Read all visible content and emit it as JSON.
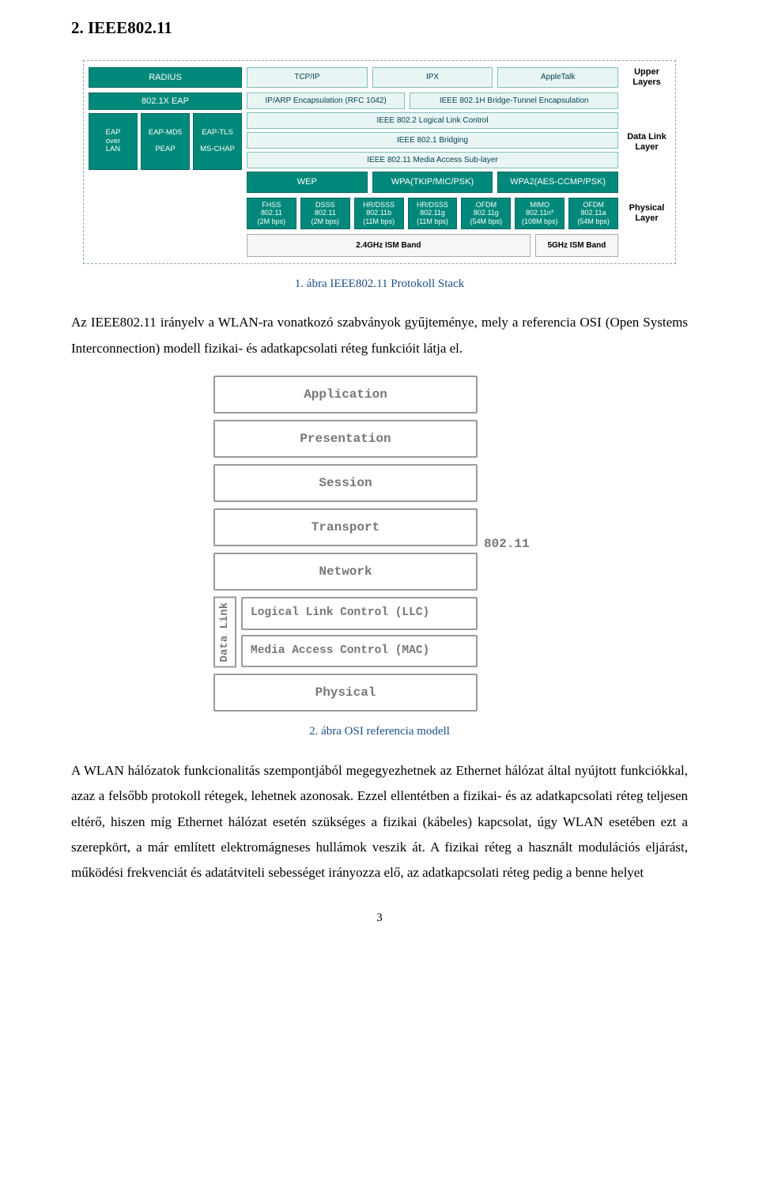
{
  "heading": "2. IEEE802.11",
  "fig1": {
    "caption": "1. ábra IEEE802.11 Protokoll Stack",
    "side_upper": "Upper\nLayers",
    "side_dll": "Data Link\nLayer",
    "side_phy": "Physical\nLayer",
    "radius": "RADIUS",
    "apps": [
      "TCP/IP",
      "IPX",
      "AppleTalk"
    ],
    "x_eap": "802.1X EAP",
    "eap_left_top": [
      "EAP\nover\nLAN",
      "EAP-MD5\n\nPEAP",
      "EAP-TLS\n\nMS-CHAP"
    ],
    "encaps": [
      "IP/ARP Encapsulation (RFC 1042)",
      "IEEE 802.1H Bridge-Tunnel Encapsulation"
    ],
    "llc": "IEEE 802.2 Logical Link Control",
    "bridging": "IEEE 802.1 Bridging",
    "mac_sub": "IEEE 802.11 Media Access Sub-layer",
    "sec": [
      "WEP",
      "WPA(TKIP/MIC/PSK)",
      "WPA2(AES-CCMP/PSK)"
    ],
    "phys": [
      {
        "l1": "FHSS",
        "l2": "802.11",
        "l3": "(2M bps)"
      },
      {
        "l1": "DSSS",
        "l2": "802.11",
        "l3": "(2M bps)"
      },
      {
        "l1": "HR/DSSS",
        "l2": "802.11b",
        "l3": "(11M bps)"
      },
      {
        "l1": "HR/DSSS",
        "l2": "802.11g",
        "l3": "(11M bps)"
      },
      {
        "l1": "OFDM",
        "l2": "802.11g",
        "l3": "(54M bps)"
      },
      {
        "l1": "MIMO",
        "l2": "802.11n*",
        "l3": "(108M bps)"
      },
      {
        "l1": "OFDM",
        "l2": "802.11a",
        "l3": "(54M bps)"
      }
    ],
    "band24": "2.4GHz ISM Band",
    "band5": "5GHz ISM Band"
  },
  "para1": "Az IEEE802.11 irányelv a WLAN-ra vonatkozó szabványok gyűjteménye, mely a referencia OSI (Open Systems Interconnection) modell fizikai- és adatkapcsolati réteg funkcióit látja el.",
  "fig2": {
    "caption": "2. ábra OSI referencia modell",
    "layers_top": [
      "Application",
      "Presentation",
      "Session",
      "Transport",
      "Network"
    ],
    "dl_label": "Data Link",
    "dl_sub": [
      "Logical Link Control (LLC)",
      "Media Access Control (MAC)"
    ],
    "physical": "Physical",
    "anno": "802.11"
  },
  "para2": "A WLAN hálózatok funkcionalitás szempontjából megegyezhetnek az Ethernet hálózat által nyújtott funkciókkal, azaz a felsőbb protokoll rétegek, lehetnek azonosak. Ezzel ellentétben a fizikai- és az adatkapcsolati réteg teljesen eltérő, hiszen míg Ethernet hálózat esetén szükséges a fizikai (kábeles) kapcsolat, úgy WLAN esetében ezt a szerepkört, a már említett elektromágneses hullámok veszik át. A fizikai réteg a használt modulációs eljárást, működési frekvenciát és adatátviteli sebességet irányozza elő, az adatkapcsolati réteg pedig a benne helyet",
  "page_number": "3"
}
